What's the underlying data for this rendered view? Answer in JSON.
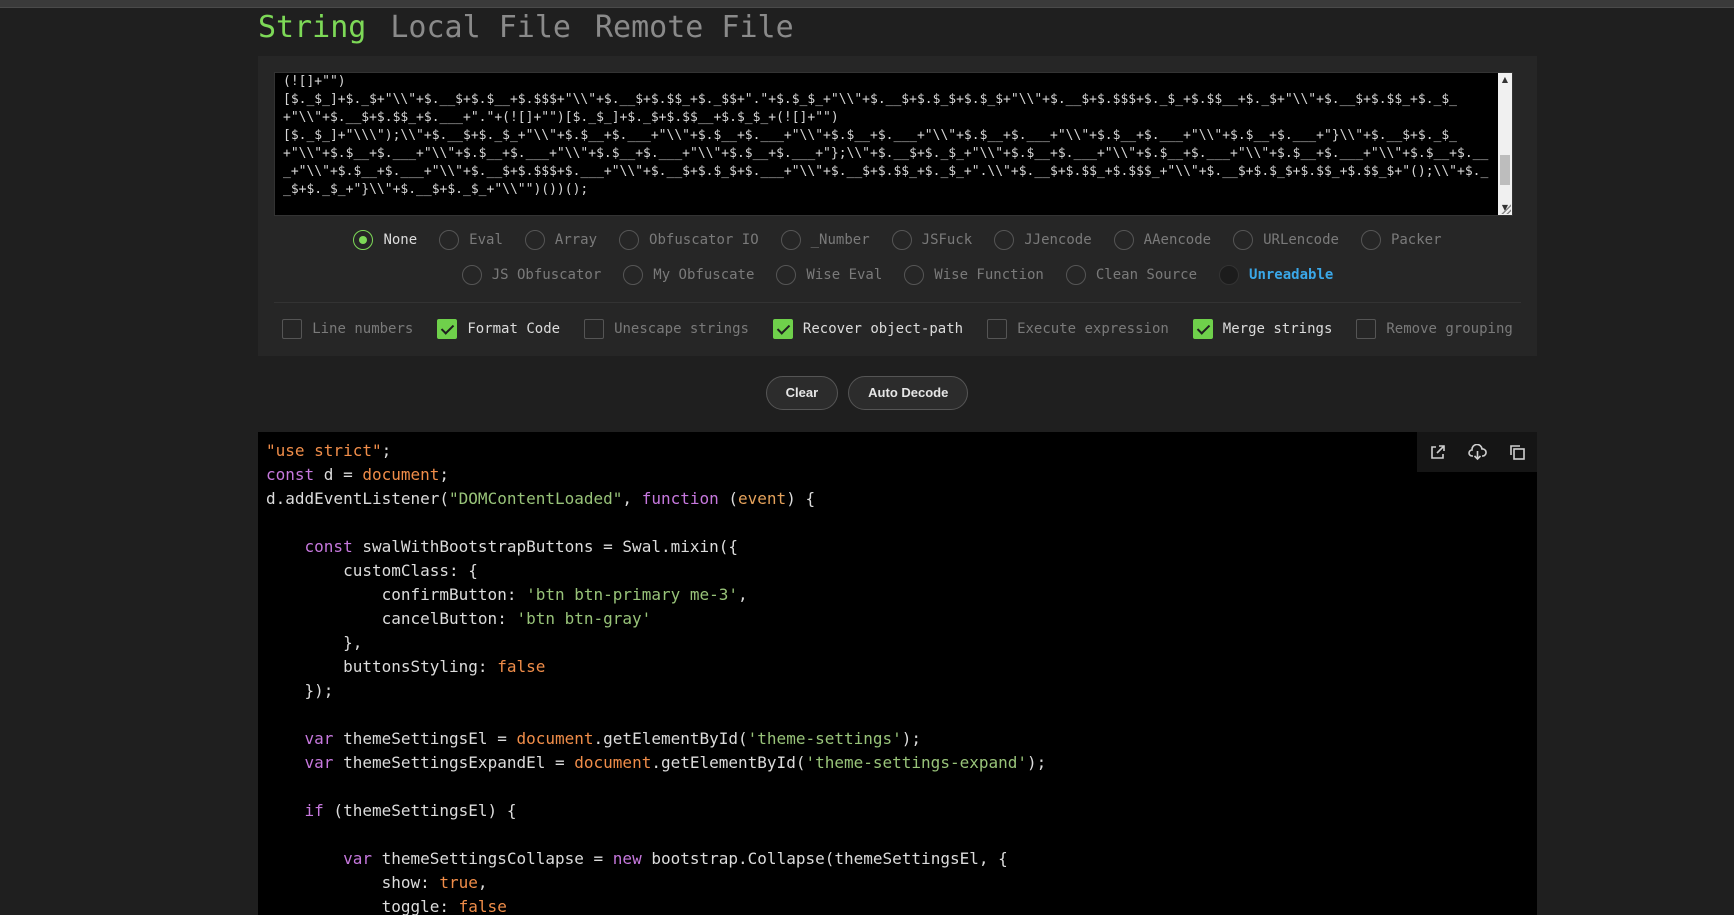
{
  "tabs": [
    {
      "label": "String"
    },
    {
      "label": "Local File"
    },
    {
      "label": "Remote File"
    }
  ],
  "input": {
    "text": "(![]+\"\")\n[$._$_]+$._$+\"\\\\\"+$.__$+$.$__+$.$$$+\"\\\\\"+$.__$+$.$$_+$._$$+\".\"+$.$_$_+\"\\\\\"+$.__$+$.$_$+$.$_$+\"\\\\\"+$.__$+$.$$$+$._$_+$.$$__+$._$+\"\\\\\"+$.__$+$.$$_+$._$_+\"\\\\\"+$.__$+$.$$_+$.___+\".\"+(![]+\"\")[$._$_]+$._$+$.$$__+$.$_$_+(![]+\"\")\n[$._$_]+\"\\\\\\\");\\\\\"+$.__$+$._$_+\"\\\\\"+$.$__+$.___+\"\\\\\"+$.$__+$.___+\"\\\\\"+$.$__+$.___+\"\\\\\"+$.$__+$.___+\"\\\\\"+$.$__+$.___+\"\\\\\"+$.$__+$.___+\"}\\\\\"+$.__$+$._$_+\"\\\\\"+$.$__+$.___+\"\\\\\"+$.$__+$.___+\"\\\\\"+$.$__+$.___+\"\\\\\"+$.$__+$.___+\"};\\\\\"+$.__$+$._$_+\"\\\\\"+$.$__+$.___+\"\\\\\"+$.$__+$.___+\"\\\\\"+$.$__+$.___+\"\\\\\"+$.$__+$.___+\"\\\\\"+$.$__+$.___+\"\\\\\"+$.__$+$.$$$+$.___+\"\\\\\"+$.__$+$.$_$+$.___+\"\\\\\"+$.__$+$.$$_+$._$_+\".\\\\\"+$.__$+$.$$_+$.$$$_+\"\\\\\"+$.__$+$.$_$+$.$$_+$.$$_$+\"();\\\\\"+$.__$+$._$_+\"}\\\\\"+$.__$+$._$_+\"\\\\\"\")())();"
  },
  "modes_row1": [
    {
      "label": "None",
      "checked": true
    },
    {
      "label": "Eval"
    },
    {
      "label": "Array"
    },
    {
      "label": "Obfuscator IO"
    },
    {
      "label": "_Number"
    },
    {
      "label": "JSFuck"
    },
    {
      "label": "JJencode"
    },
    {
      "label": "AAencode"
    },
    {
      "label": "URLencode"
    },
    {
      "label": "Packer"
    }
  ],
  "modes_row2": [
    {
      "label": "JS Obfuscator"
    },
    {
      "label": "My Obfuscate"
    },
    {
      "label": "Wise Eval"
    },
    {
      "label": "Wise Function"
    },
    {
      "label": "Clean Source"
    },
    {
      "label": "Unreadable",
      "special": true
    }
  ],
  "options": [
    {
      "label": "Line numbers",
      "checked": false
    },
    {
      "label": "Format Code",
      "checked": true
    },
    {
      "label": "Unescape strings",
      "checked": false
    },
    {
      "label": "Recover object-path",
      "checked": true
    },
    {
      "label": "Execute expression",
      "checked": false
    },
    {
      "label": "Merge strings",
      "checked": true
    },
    {
      "label": "Remove grouping",
      "checked": false
    }
  ],
  "buttons": {
    "clear": "Clear",
    "auto_decode": "Auto Decode"
  },
  "output_tools": [
    "open-external-icon",
    "download-icon",
    "copy-icon"
  ],
  "colors": {
    "accent": "#7dd957",
    "link": "#3aa7e8",
    "keyword": "#c678dd",
    "string": "#98c379",
    "literal": "#f08d49"
  },
  "code": {
    "l1_str": "\"use strict\"",
    "l1_end": ";",
    "l2_kw": "const",
    "l2_mid": " d = ",
    "l2_obj": "document",
    "l2_end": ";",
    "l3_a": "d.addEventListener(",
    "l3_str": "\"DOMContentLoaded\"",
    "l3_b": ", ",
    "l3_kw": "function",
    "l3_c": " (",
    "l3_ev": "event",
    "l3_d": ") {",
    "l5_kw": "const",
    "l5_rest": " swalWithBootstrapButtons = Swal.mixin({",
    "l6": "customClass: {",
    "l7_a": "confirmButton: ",
    "l7_str": "'btn btn-primary me-3'",
    "l7_b": ",",
    "l8_a": "cancelButton: ",
    "l8_str": "'btn btn-gray'",
    "l9": "},",
    "l10_a": "buttonsStyling: ",
    "l10_bool": "false",
    "l11": "});",
    "l13_kw": "var",
    "l13_a": " themeSettingsEl = ",
    "l13_obj": "document",
    "l13_b": ".getElementById(",
    "l13_str": "'theme-settings'",
    "l13_c": ");",
    "l14_kw": "var",
    "l14_a": " themeSettingsExpandEl = ",
    "l14_obj": "document",
    "l14_b": ".getElementById(",
    "l14_str": "'theme-settings-expand'",
    "l14_c": ");",
    "l16_kw": "if",
    "l16_rest": " (themeSettingsEl) {",
    "l18_kw": "var",
    "l18_a": " themeSettingsCollapse = ",
    "l18_kw2": "new",
    "l18_b": " bootstrap.Collapse(themeSettingsEl, {",
    "l19_a": "show: ",
    "l19_bool": "true",
    "l19_b": ",",
    "l20_a": "toggle: ",
    "l20_bool": "false"
  }
}
